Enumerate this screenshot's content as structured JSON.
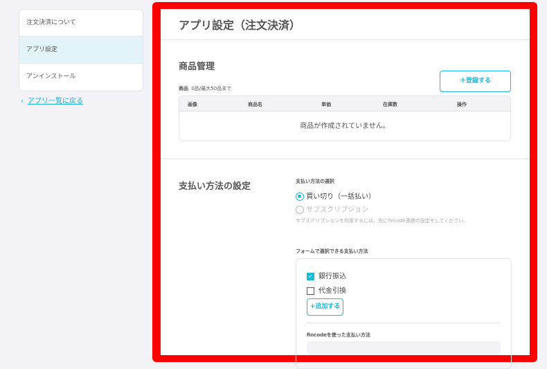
{
  "sidebar": {
    "items": [
      {
        "label": "注文決済について"
      },
      {
        "label": "アプリ設定"
      },
      {
        "label": "アンインストール"
      }
    ],
    "back_link": "アプリ一覧に戻る"
  },
  "main": {
    "title": "アプリ設定（注文決済）",
    "products": {
      "heading": "商品管理",
      "register_button": "＋登録する",
      "count_label": "商品",
      "count_value": "0品/最大50品まで",
      "columns": [
        "画像",
        "商品名",
        "単価",
        "在庫数",
        "操作"
      ],
      "empty": "商品が作成されていません。"
    },
    "payment": {
      "heading": "支払い方法の設定",
      "select_label": "支払い方法の選択",
      "options": [
        {
          "label": "買い切り（一括払い）",
          "selected": true,
          "disabled": false
        },
        {
          "label": "サブスクリプション",
          "selected": false,
          "disabled": true
        }
      ],
      "note": "サブスクリプションを利用するには、先にfincode連携の設定をしてください。",
      "form_label": "フォームで選択できる支払い方法",
      "methods": [
        {
          "label": "銀行振込",
          "checked": true
        },
        {
          "label": "代金引換",
          "checked": false
        }
      ],
      "add_button": "+追加する",
      "fincode_label": "fincodeを使った支払い方法"
    }
  },
  "colors": {
    "accent": "#19bcd8",
    "frame": "#ff0000"
  }
}
